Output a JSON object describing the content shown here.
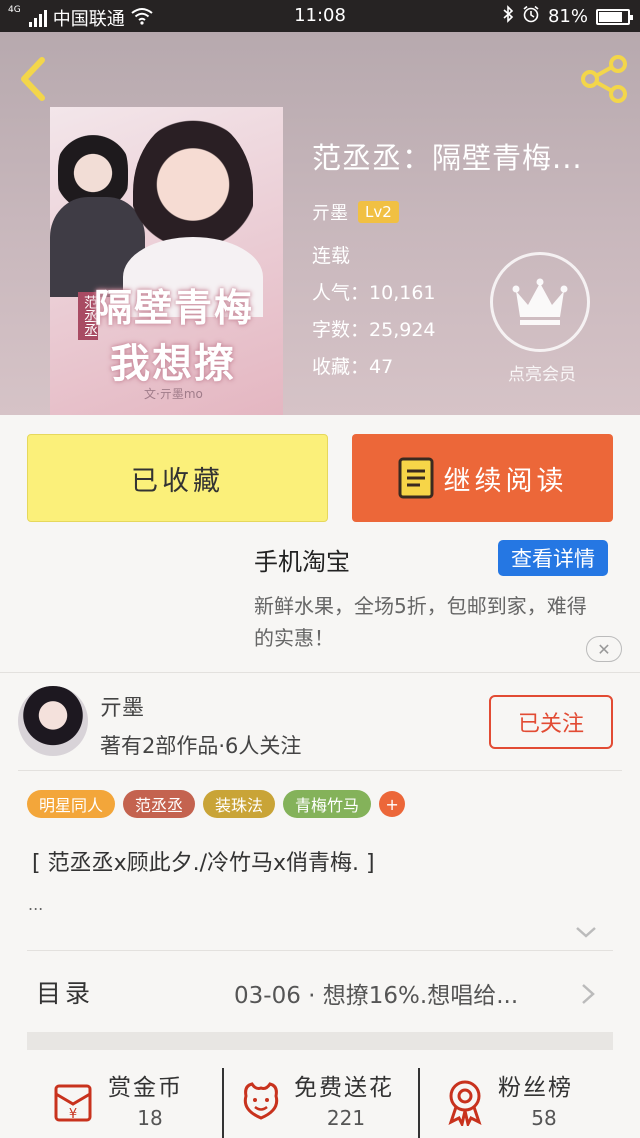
{
  "status_bar": {
    "network": "4G",
    "carrier": "中国联通",
    "time": "11:08",
    "battery": "81%",
    "battery_level": 0.81
  },
  "book": {
    "title": "范丞丞：隔壁青梅...",
    "author": "亓墨",
    "level": "Lv2",
    "status": "连载",
    "popularity_label": "人气：",
    "popularity": "10,161",
    "words_label": "字数：",
    "words": "25,924",
    "favorites_label": "收藏：",
    "favorites": "47",
    "vip_label": "点亮会员",
    "cover_title_1": "隔壁青梅",
    "cover_title_2": "我想撩",
    "cover_tag": "范丞丞",
    "cover_byline": "文·亓墨mo"
  },
  "actions": {
    "collected_label": "已收藏",
    "read_label": "继续阅读"
  },
  "ad": {
    "title": "手机淘宝",
    "button": "查看详情",
    "description": "新鲜水果，全场5折，包邮到家，难得的实惠！",
    "close": "✕"
  },
  "author_card": {
    "name": "亓墨",
    "meta": "著有2部作品·6人关注",
    "follow_label": "已关注"
  },
  "tags": [
    {
      "label": "明星同人",
      "color": "#f3a63a"
    },
    {
      "label": "范丞丞",
      "color": "#c4634f"
    },
    {
      "label": "装珠法",
      "color": "#c9a437"
    },
    {
      "label": "青梅竹马",
      "color": "#84b25a"
    }
  ],
  "tag_add": "+",
  "synopsis": "[ 范丞丞x顾此夕./冷竹马x俏青梅. ]",
  "synopsis_more": "...",
  "toc": {
    "label": "目录",
    "latest": "03-06 · 想撩16%.想唱给..."
  },
  "bottom": {
    "reward_label": "赏金币",
    "reward_value": "18",
    "flower_label": "免费送花",
    "flower_value": "221",
    "fans_label": "粉丝榜",
    "fans_value": "58"
  },
  "colors": {
    "accent_orange": "#ec6739",
    "collected_yellow": "#fbf07a",
    "link_blue": "#2577e3",
    "follow_red": "#e24b33",
    "lv_badge": "#f1c043"
  }
}
